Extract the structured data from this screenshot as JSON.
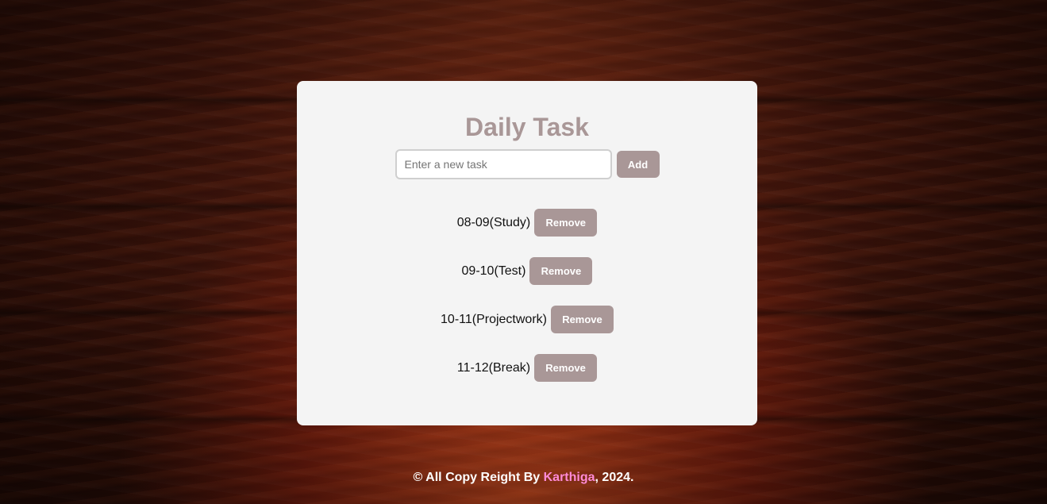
{
  "app": {
    "title": "Daily Task"
  },
  "input": {
    "placeholder": "Enter a new task",
    "value": ""
  },
  "buttons": {
    "add_label": "Add",
    "remove_label": "Remove"
  },
  "tasks": [
    {
      "text": "08-09(Study)"
    },
    {
      "text": "09-10(Test)"
    },
    {
      "text": "10-11(Projectwork)"
    },
    {
      "text": "11-12(Break)"
    }
  ],
  "footer": {
    "prefix": "© All Copy Reight By ",
    "author": "Karthiga",
    "suffix": ", 2024."
  },
  "colors": {
    "accent": "#a99797",
    "card_bg": "#f4f4f4",
    "author_highlight": "#ff8ad6"
  }
}
